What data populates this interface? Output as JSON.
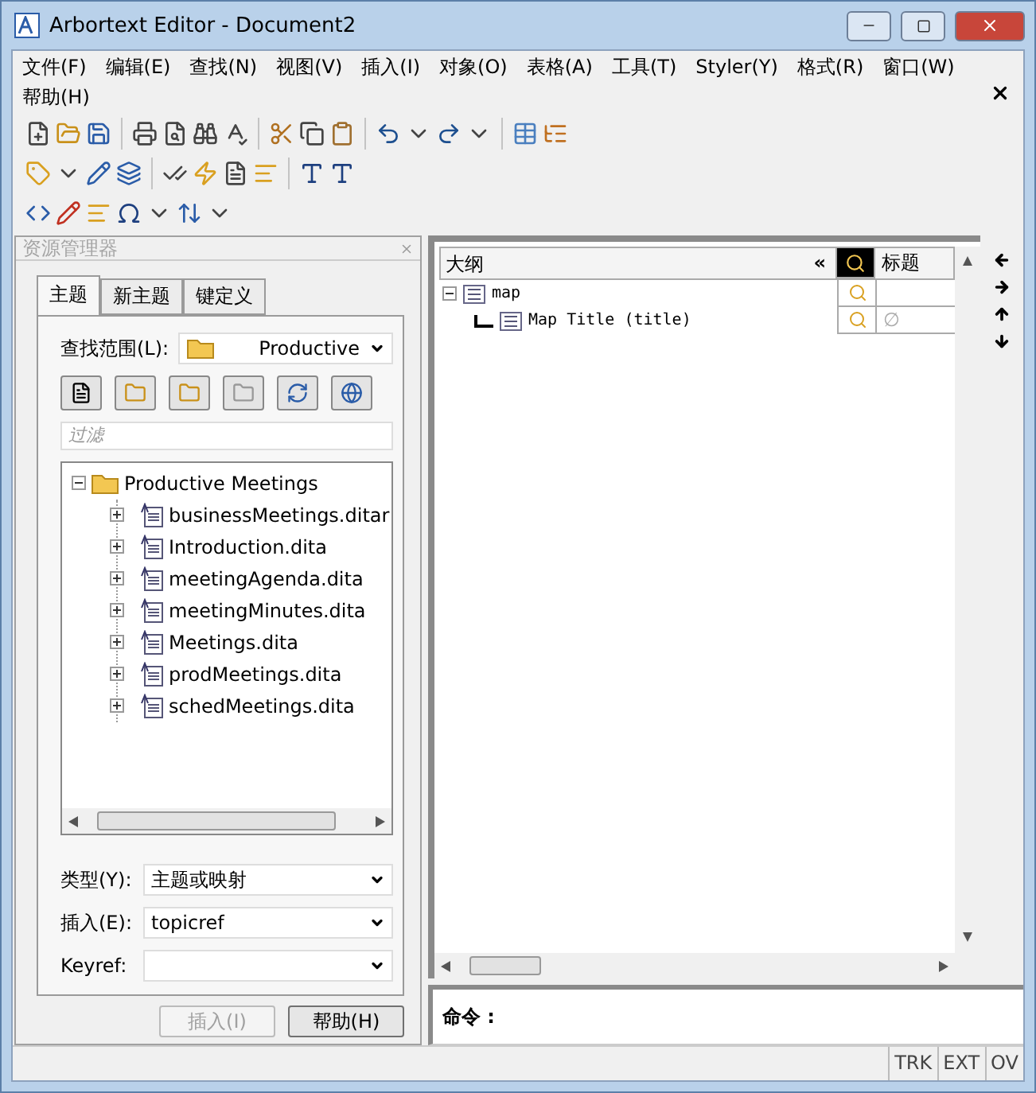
{
  "window": {
    "title": "Arbortext Editor - Document2"
  },
  "menu": [
    "文件(F)",
    "编辑(E)",
    "查找(N)",
    "视图(V)",
    "插入(I)",
    "对象(O)",
    "表格(A)",
    "工具(T)",
    "Styler(Y)",
    "格式(R)",
    "窗口(W)",
    "帮助(H)"
  ],
  "explorer": {
    "title": "资源管理器",
    "tabs": [
      {
        "label": "主题",
        "selected": true
      },
      {
        "label": "新主题",
        "selected": false
      },
      {
        "label": "键定义",
        "selected": false
      }
    ],
    "find_in": {
      "label": "查找范围(L):",
      "value": "Productive"
    },
    "filter": {
      "placeholder": "过滤"
    },
    "tree": {
      "label": "Productive Meetings",
      "expanded": true,
      "children": [
        {
          "label": "businessMeetings.ditar",
          "expanded": false
        },
        {
          "label": "Introduction.dita",
          "expanded": false
        },
        {
          "label": "meetingAgenda.dita",
          "expanded": false
        },
        {
          "label": "meetingMinutes.dita",
          "expanded": false
        },
        {
          "label": "Meetings.dita",
          "expanded": false
        },
        {
          "label": "prodMeetings.dita",
          "expanded": false
        },
        {
          "label": "schedMeetings.dita",
          "expanded": false
        }
      ]
    },
    "fields": [
      {
        "label": "类型(Y):",
        "value": "主题或映射"
      },
      {
        "label": "插入(E):",
        "value": "topicref"
      },
      {
        "label": "Keyref:"
      }
    ],
    "buttons": [
      {
        "label": "插入(I)",
        "disabled": true
      },
      {
        "label": "帮助(H)",
        "disabled": false
      }
    ]
  },
  "outline": {
    "header": "大纲",
    "collapse": "«",
    "title_column": "标题",
    "rows": [
      {
        "label": "map",
        "expanded": true,
        "children": [
          {
            "label": "Map Title (title)",
            "title": "∅"
          }
        ]
      }
    ]
  },
  "command": {
    "label": "命令 :"
  },
  "status_bar": [
    "TRK",
    "EXT",
    "OV"
  ]
}
